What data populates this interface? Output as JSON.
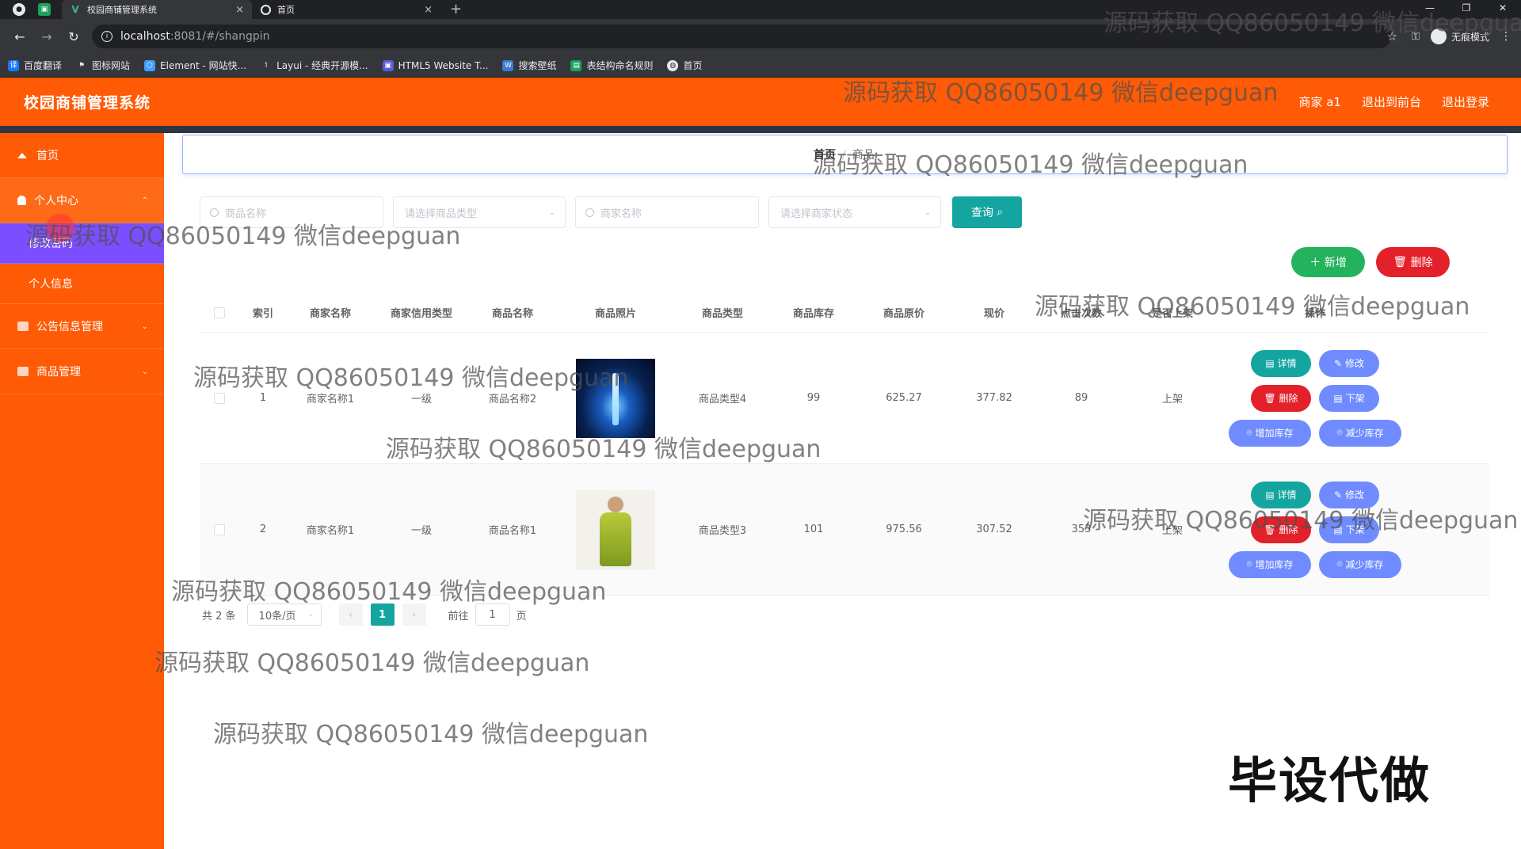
{
  "browser": {
    "tabs": [
      {
        "title": "校园商铺管理系统",
        "close": "×"
      },
      {
        "title": "首页",
        "close": "×"
      }
    ],
    "new_tab": "+",
    "url_host": "localhost",
    "url_path": ":8081/#/shangpin",
    "incognito_label": "无痕模式",
    "bookmarks": [
      {
        "label": "百度翻译",
        "color": "#1677ff"
      },
      {
        "label": "图标网站",
        "color": "#e8eaed"
      },
      {
        "label": "Element - 网站快...",
        "color": "#409eff"
      },
      {
        "label": "Layui - 经典开源模...",
        "color": "#e8eaed"
      },
      {
        "label": "HTML5 Website T...",
        "color": "#5b5bd6"
      },
      {
        "label": "搜索壁纸",
        "color": "#3b7bd4"
      },
      {
        "label": "表结构命名规则",
        "color": "#1aa260"
      },
      {
        "label": "首页",
        "color": "#e8eaed"
      }
    ]
  },
  "header": {
    "title": "校园商铺管理系统",
    "user": "商家 a1",
    "back_front": "退出到前台",
    "logout": "退出登录"
  },
  "sidebar": {
    "items": [
      {
        "label": "首页"
      },
      {
        "label": "个人中心"
      },
      {
        "label": "修改密码"
      },
      {
        "label": "个人信息"
      },
      {
        "label": "公告信息管理"
      },
      {
        "label": "商品管理"
      }
    ]
  },
  "breadcrumb": {
    "home": "首页",
    "separator": "/",
    "current": "商品"
  },
  "search": {
    "product_name_placeholder": "商品名称",
    "product_type_placeholder": "请选择商品类型",
    "merchant_name_placeholder": "商家名称",
    "merchant_status_placeholder": "请选择商家状态",
    "query_label": "查询"
  },
  "actions": {
    "add_label": "新增",
    "delete_label": "删除"
  },
  "table": {
    "headers": [
      "索引",
      "商家名称",
      "商家信用类型",
      "商品名称",
      "商品照片",
      "商品类型",
      "商品库存",
      "商品原价",
      "现价",
      "点击次数",
      "是否上架",
      "操作"
    ],
    "rows": [
      {
        "index": "1",
        "merchant": "商家名称1",
        "credit": "一级",
        "name": "商品名称2",
        "type": "商品类型4",
        "stock": "99",
        "orig": "625.27",
        "now": "377.82",
        "clicks": "89",
        "shelf": "上架"
      },
      {
        "index": "2",
        "merchant": "商家名称1",
        "credit": "一级",
        "name": "商品名称1",
        "type": "商品类型3",
        "stock": "101",
        "orig": "975.56",
        "now": "307.52",
        "clicks": "353",
        "shelf": "上架"
      }
    ],
    "ops": {
      "detail": "详情",
      "edit": "修改",
      "remove": "删除",
      "down": "下架",
      "inc": "增加库存",
      "dec": "减少库存"
    }
  },
  "pagination": {
    "total": "共 2 条",
    "page_size": "10条/页",
    "prev": "‹",
    "current": "1",
    "next": "›",
    "goto": "前往",
    "goto_value": "1",
    "page_unit": "页"
  },
  "corner_text": "毕设代做",
  "watermark": "源码获取 QQ86050149 微信deepguan"
}
